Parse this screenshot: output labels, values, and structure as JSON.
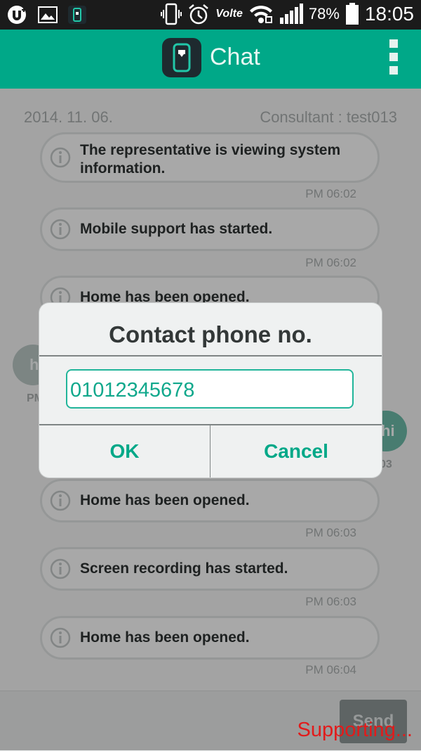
{
  "status_bar": {
    "battery_percent": "78%",
    "time": "18:05",
    "network_label": "Volte"
  },
  "header": {
    "title": "Chat",
    "logo_icon": "phone-app-logo-icon",
    "menu_icon": "overflow-menu-icon"
  },
  "chat": {
    "date": "2014. 11. 06.",
    "consultant": "Consultant : test013",
    "messages": [
      {
        "text": "The representative is viewing system information.",
        "time": "PM 06:02"
      },
      {
        "text": "Mobile support has started.",
        "time": "PM 06:02"
      },
      {
        "text": "Home has been opened.",
        "time": ""
      },
      {
        "text": "Home has been opened.",
        "time": "PM 06:03"
      },
      {
        "text": "Screen recording has started.",
        "time": "PM 06:03"
      },
      {
        "text": "Home has been opened.",
        "time": "PM 06:04"
      }
    ],
    "user_bubble_left": {
      "text": "h",
      "time": "PM"
    },
    "user_bubble_right": {
      "text": "hi",
      "time": "03"
    }
  },
  "input": {
    "send_label": "Send",
    "overlay_status": "Supporting..."
  },
  "dialog": {
    "title": "Contact phone no.",
    "phone_value": "01012345678",
    "ok_label": "OK",
    "cancel_label": "Cancel"
  }
}
